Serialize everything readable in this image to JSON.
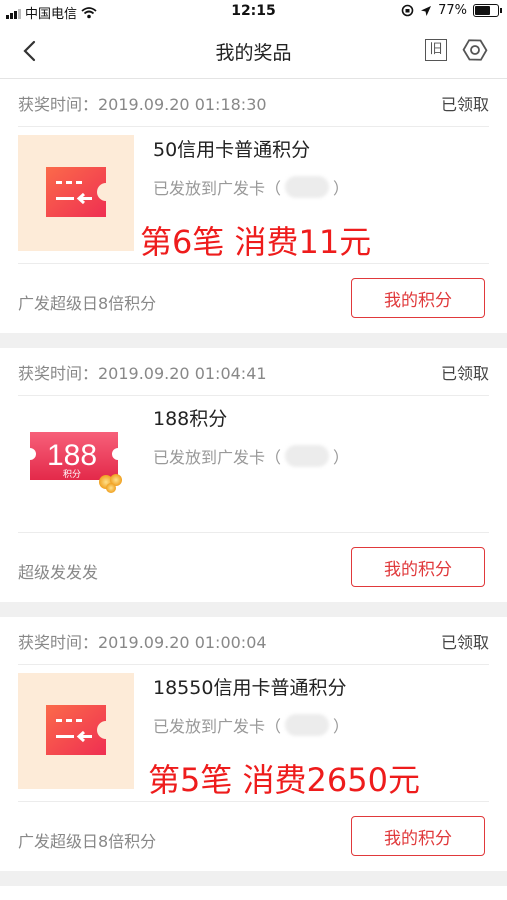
{
  "status_bar": {
    "carrier": "中国电信",
    "time": "12:15",
    "battery": "77%",
    "battery_level": 0.77
  },
  "header": {
    "title": "我的奖品",
    "right_icon_a": "旧"
  },
  "cards": [
    {
      "time_label": "获奖时间：2019.09.20 01:18:30",
      "status": "已领取",
      "image_icon": "ticket-icon",
      "title": "50信用卡普通积分",
      "sub_prefix": "已发放到广发卡（",
      "sub_suffix": "）",
      "annotation": "第6笔 消费11元",
      "footer_label": "广发超级日8倍积分",
      "button": "我的积分"
    },
    {
      "time_label": "获奖时间：2019.09.20 01:04:41",
      "status": "已领取",
      "image_icon": "points-coupon-icon",
      "image_number": "188",
      "image_caption": "积分",
      "title": "188积分",
      "sub_prefix": "已发放到广发卡（",
      "sub_suffix": "）",
      "footer_label": "超级发发发",
      "button": "我的积分"
    },
    {
      "time_label": "获奖时间：2019.09.20 01:00:04",
      "status": "已领取",
      "image_icon": "ticket-icon",
      "title": "18550信用卡普通积分",
      "sub_prefix": "已发放到广发卡（",
      "sub_suffix": "）",
      "annotation": "第5笔 消费2650元",
      "footer_label": "广发超级日8倍积分",
      "button": "我的积分"
    }
  ],
  "colors": {
    "accent": "#e0393b",
    "annotation": "#ee1c1c",
    "ticket_bg": "#fdebd8"
  }
}
